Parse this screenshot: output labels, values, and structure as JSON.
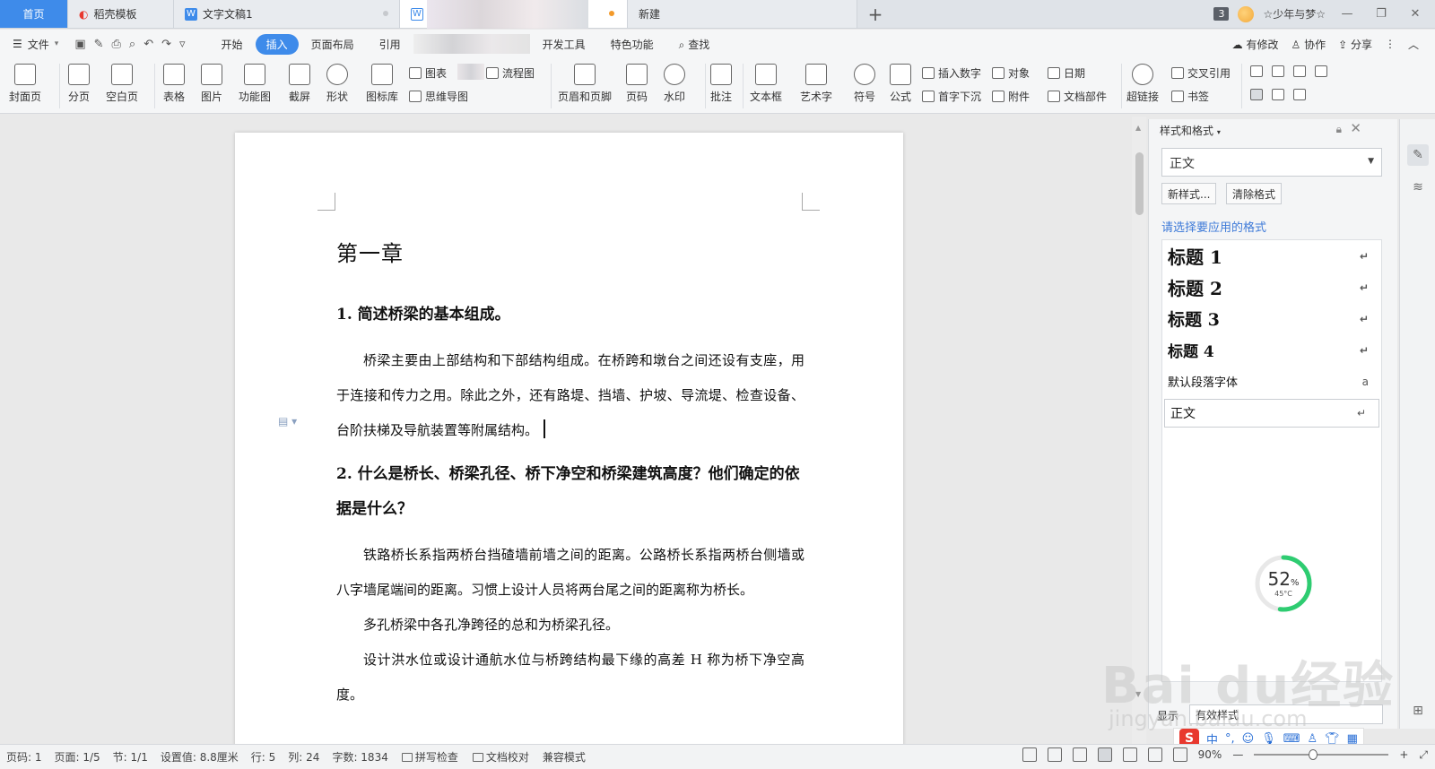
{
  "tabs": {
    "home": "首页",
    "docer": "稻壳模板",
    "doc1": "文字文稿1",
    "new_tab": "新建",
    "add": "+",
    "count": "3",
    "user": "☆少年与梦☆"
  },
  "window": {
    "minimize": "—",
    "restore": "❐",
    "close": "✕"
  },
  "menu": {
    "file": "文件",
    "items": [
      "开始",
      "插入",
      "页面布局",
      "引用",
      "开发工具",
      "特色功能"
    ],
    "active": "插入",
    "search": "查找",
    "right": [
      "有修改",
      "协作",
      "分享"
    ]
  },
  "ribbon": {
    "big": [
      "封面页",
      "分页",
      "空白页",
      "表格",
      "图片",
      "功能图",
      "截屏",
      "形状",
      "图标库",
      "页眉和页脚",
      "页码",
      "水印",
      "批注",
      "文本框",
      "艺术字",
      "符号",
      "公式",
      "超链接"
    ],
    "small": [
      "图表",
      "流程图",
      "思维导图",
      "插入数字",
      "对象",
      "日期",
      "首字下沉",
      "附件",
      "文档部件",
      "交叉引用",
      "书签"
    ]
  },
  "document": {
    "chapter": "第一章",
    "q1": "1. 简述桥梁的基本组成。",
    "p1": "桥梁主要由上部结构和下部结构组成。在桥跨和墩台之间还设有支座，用于连接和传力之用。除此之外，还有路堤、挡墙、护坡、导流堤、检查设备、台阶扶梯及导航装置等附属结构。",
    "q2": "2. 什么是桥长、桥梁孔径、桥下净空和桥梁建筑高度？他们确定的依据是什么？",
    "p2": "铁路桥长系指两桥台挡碴墙前墙之间的距离。公路桥长系指两桥台侧墙或八字墙尾端间的距离。习惯上设计人员将两台尾之间的距离称为桥长。",
    "p3": "多孔桥梁中各孔净跨径的总和为桥梁孔径。",
    "p4": "设计洪水位或设计通航水位与桥跨结构最下缘的高差 H 称为桥下净空高度。"
  },
  "panel": {
    "title": "样式和格式",
    "current": "正文",
    "new_style": "新样式...",
    "clear": "清除格式",
    "hint": "请选择要应用的格式",
    "styles": [
      "标题 1",
      "标题 2",
      "标题 3",
      "标题 4",
      "默认段落字体",
      "正文"
    ],
    "show_label": "显示",
    "show_value": "有效样式"
  },
  "gauge": {
    "percent": 52,
    "unit": "%",
    "temp": "45°C",
    "color": "#2ecc71"
  },
  "watermark": {
    "brand": "Bai du经验",
    "url": "jingyan.baidu.com"
  },
  "ime": {
    "logo": "S",
    "mode": "中",
    "punct": "°,"
  },
  "status": {
    "page": "页码: 1",
    "pages": "页面: 1/5",
    "section": "节: 1/1",
    "setting": "设置值: 8.8厘米",
    "row": "行: 5",
    "col": "列: 24",
    "words": "字数: 1834",
    "spell": "拼写检查",
    "proof": "文档校对",
    "compat": "兼容模式",
    "zoom": "90%",
    "zoom_level": 0.44
  },
  "colors": {
    "accent": "#3e8bea",
    "hint": "#3e7ad8"
  }
}
